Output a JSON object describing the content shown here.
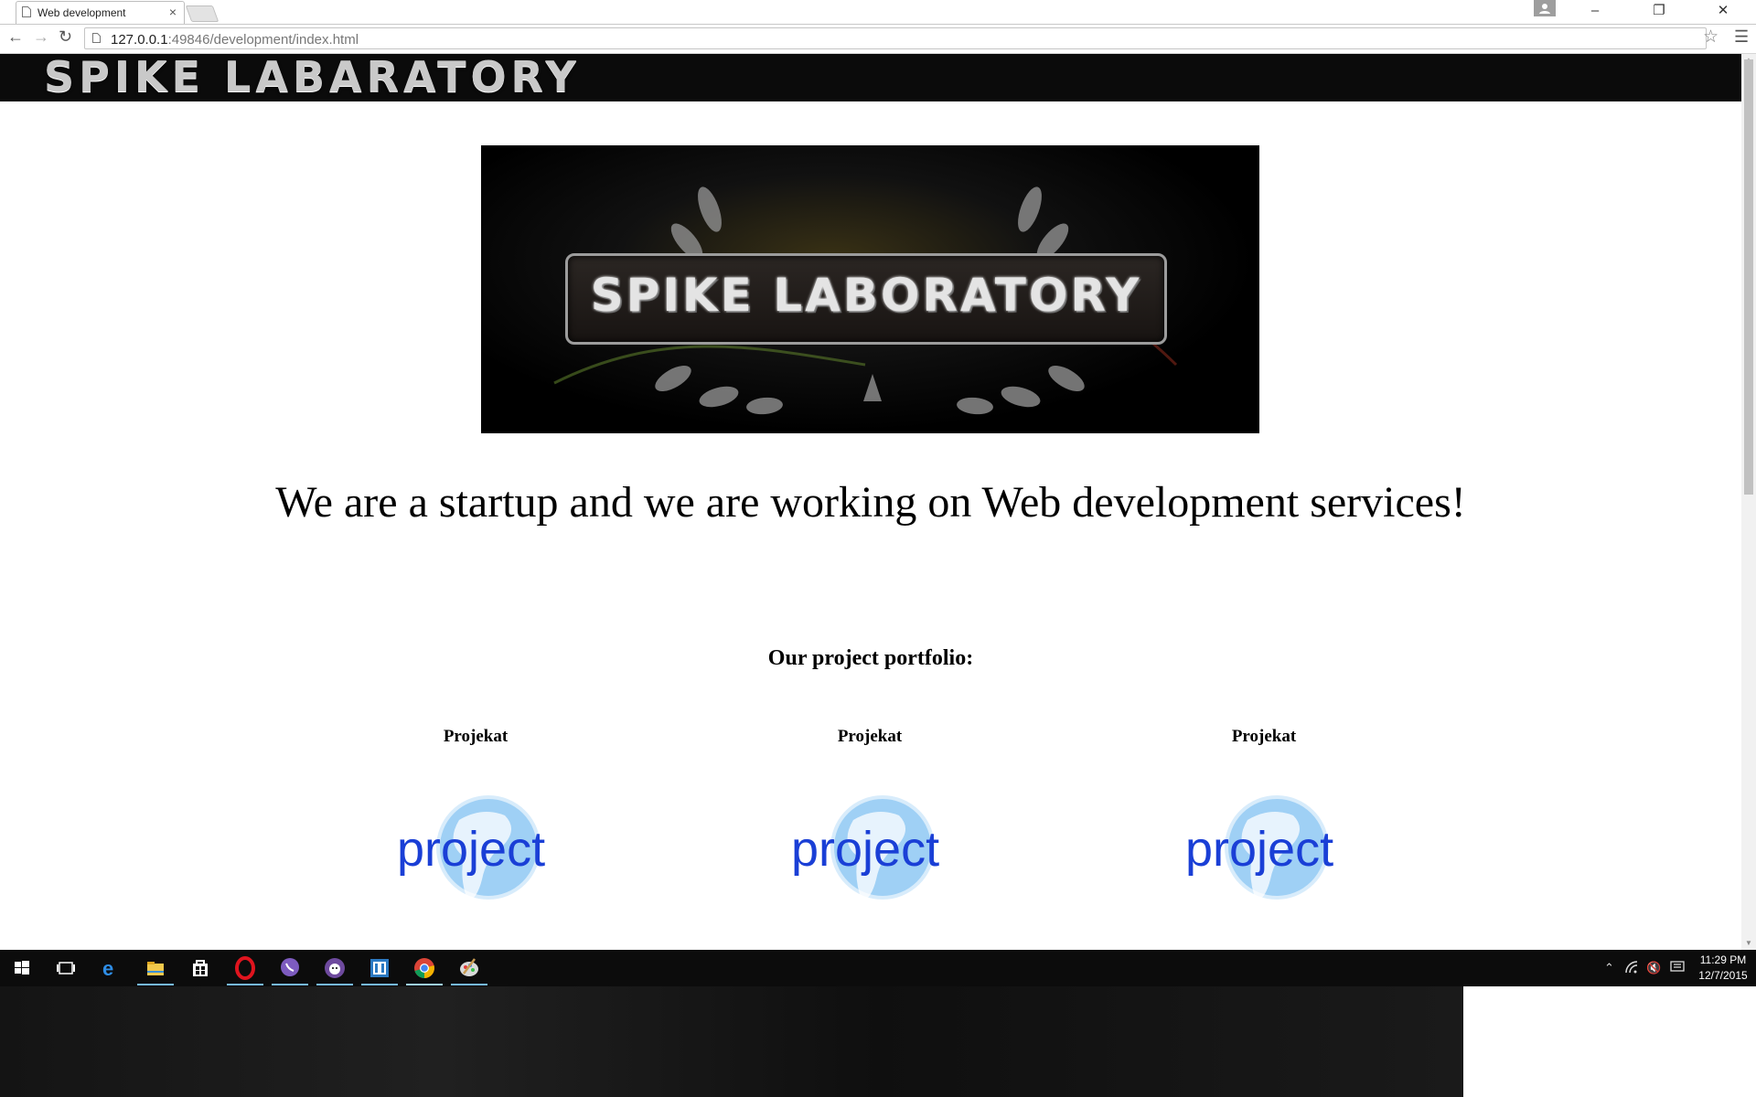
{
  "browser": {
    "tab_title": "Web development",
    "tab_close": "×",
    "url_host": "127.0.0.1",
    "url_rest": ":49846/development/index.html",
    "window_buttons": [
      "–",
      "❐",
      "✕"
    ]
  },
  "site": {
    "header_title": "SPIKE LABARATORY",
    "banner_text": "SPIKE LABORATORY",
    "headline": "We are a startup and we are working on Web development services!",
    "portfolio_heading": "Our project portfolio:",
    "projects": [
      {
        "label": "Projekat",
        "logo_text": "project"
      },
      {
        "label": "Projekat",
        "logo_text": "project"
      },
      {
        "label": "Projekat",
        "logo_text": "project"
      }
    ]
  },
  "taskbar": {
    "apps": [
      "windows-start",
      "task-view",
      "edge",
      "file-explorer",
      "store",
      "opera",
      "viber",
      "github",
      "visual-studio",
      "chrome",
      "paint"
    ],
    "time": "11:29 PM",
    "date": "12/7/2015"
  },
  "colors": {
    "header_bg": "#0b0b0b",
    "taskbar_bg": "#0c0c0c",
    "logo_blue": "#1a3fd6",
    "globe_light": "#9fd0f5"
  }
}
